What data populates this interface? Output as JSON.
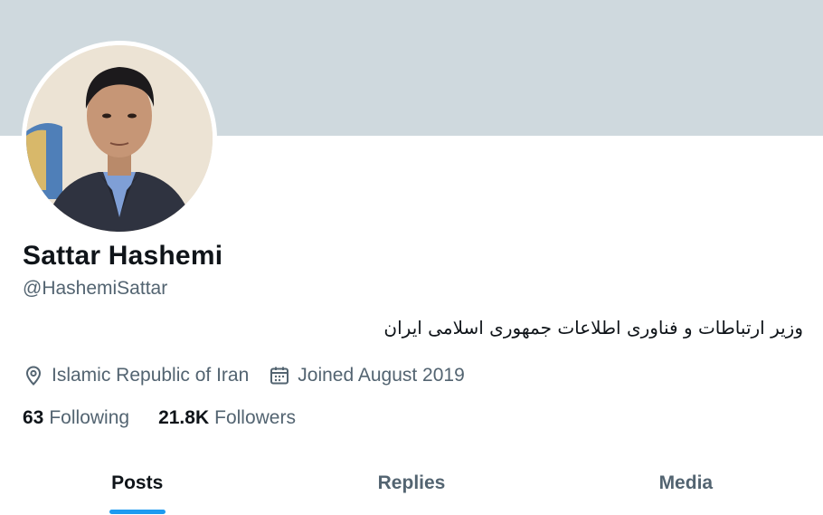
{
  "profile": {
    "name": "Sattar Hashemi",
    "handle": "@HashemiSattar",
    "bio": "وزیر ارتباطات و فناوری اطلاعات جمهوری اسلامی ایران",
    "location": "Islamic Republic of Iran",
    "joined": "Joined August 2019",
    "location_icon": "location-pin-icon",
    "joined_icon": "calendar-icon"
  },
  "stats": {
    "following_count": "63",
    "following_label": "Following",
    "followers_count": "21.8K",
    "followers_label": "Followers"
  },
  "tabs": [
    {
      "label": "Posts",
      "active": true
    },
    {
      "label": "Replies",
      "active": false
    },
    {
      "label": "Media",
      "active": false
    }
  ],
  "colors": {
    "banner": "#cfd9de",
    "accent": "#1d9bf0",
    "text_primary": "#0f1419",
    "text_secondary": "#536471"
  }
}
